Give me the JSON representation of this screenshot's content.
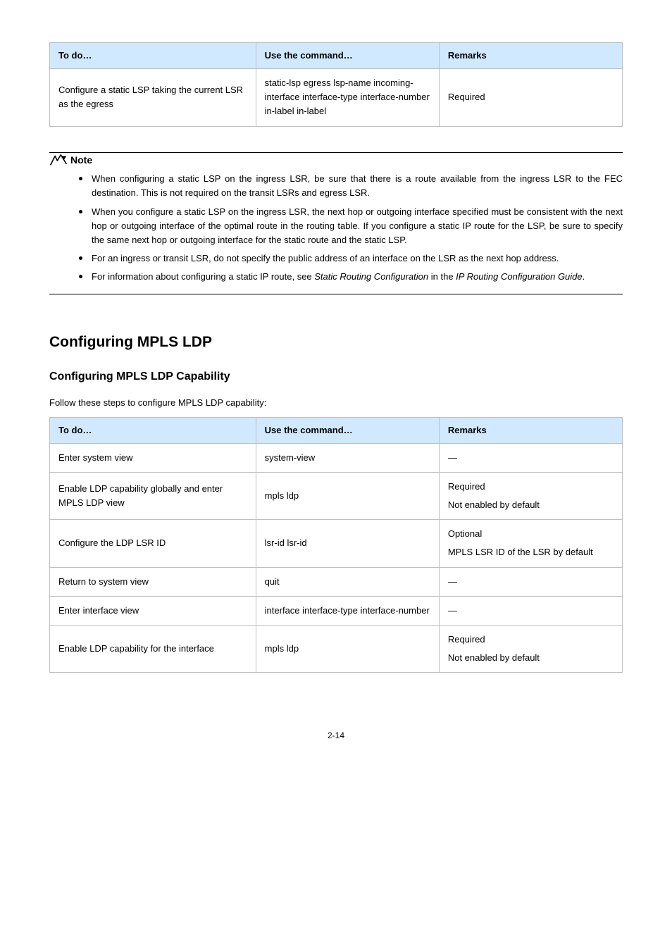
{
  "table1": {
    "headers": [
      "To do…",
      "Use the command…",
      "Remarks"
    ],
    "row": {
      "c0": "Configure a static LSP taking the current LSR as the egress",
      "c1": "static-lsp egress lsp-name incoming-interface interface-type interface-number in-label in-label",
      "c2": "Required"
    }
  },
  "note": {
    "title": "Note",
    "items": [
      {
        "pre": "When configuring a static LSP on the ingress LSR, be sure that there is a route available from the ingress LSR to the FEC destination. This is not required on the transit LSRs and egress LSR."
      },
      {
        "pre": "When you configure a static LSP on the ingress LSR, the next hop or outgoing interface specified must be consistent with the next hop or outgoing interface of the optimal route in the routing table. If you configure a static IP route for the LSP, be sure to specify the same next hop or outgoing interface for the static route and the static LSP."
      },
      {
        "pre": "For an ingress or transit LSR, do not specify the public address of an interface on the LSR as the next hop address."
      },
      {
        "pre": "For information about configuring a static IP route, see ",
        "ital1": "Static Routing Configuration",
        "mid": " in the ",
        "ital2": "IP Routing Configuration Guide",
        "post": "."
      }
    ]
  },
  "heading1": "Configuring MPLS LDP",
  "heading2": "Configuring MPLS LDP Capability",
  "lead": "Follow these steps to configure MPLS LDP capability:",
  "table2": {
    "headers": [
      "To do…",
      "Use the command…",
      "Remarks"
    ],
    "rows": [
      {
        "c0": "Enter system view",
        "c1": "system-view",
        "c2": "—"
      },
      {
        "c0": "Enable LDP capability globally and enter MPLS LDP view",
        "c1": "mpls ldp",
        "c2a": "Required",
        "c2b": "Not enabled by default"
      },
      {
        "c0": "Configure the LDP LSR ID",
        "c1": "lsr-id lsr-id",
        "c2a": "Optional",
        "c2b": "MPLS LSR ID of the LSR by default"
      },
      {
        "c0": "Return to system view",
        "c1": "quit",
        "c2": "—"
      },
      {
        "c0": "Enter interface view",
        "c1": "interface interface-type interface-number",
        "c2": "—"
      },
      {
        "c0": "Enable LDP capability for the interface",
        "c1": "mpls ldp",
        "c2a": "Required",
        "c2b": "Not enabled by default"
      }
    ]
  },
  "pageNumber": "2-14"
}
